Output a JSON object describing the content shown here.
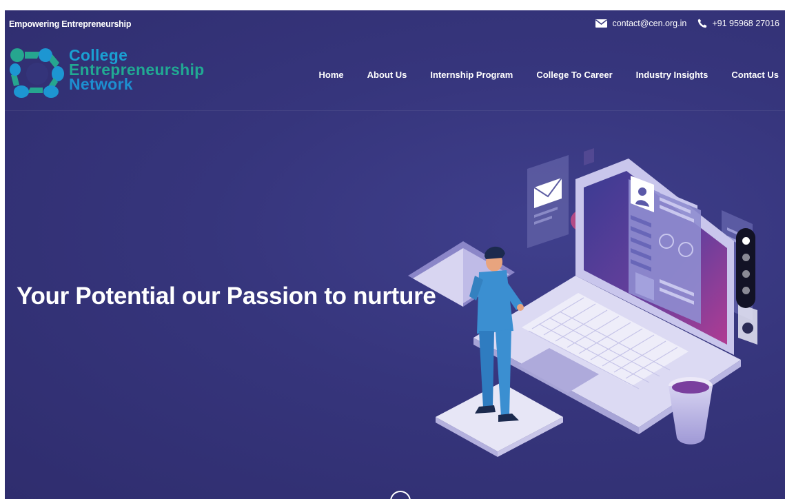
{
  "topbar": {
    "tagline": "Empowering Entrepreneurship",
    "email": "contact@cen.org.in",
    "phone": "+91 95968 27016",
    "email_icon": "envelope-icon",
    "phone_icon": "phone-icon"
  },
  "logo": {
    "line1": "College",
    "line2": "Entrepreneurship",
    "line3": "Network",
    "mark_icon": "network-circle-logo"
  },
  "nav": {
    "items": [
      "Home",
      "About Us",
      "Internship Program",
      "College To Career",
      "Industry Insights",
      "Contact Us"
    ]
  },
  "hero": {
    "title": "Your Potential our Passion to nurture",
    "slides_total": 4,
    "slide_active": 1
  },
  "colors": {
    "background": "#36357c",
    "logo_blue": "#1aa0d3",
    "logo_teal": "#21a993",
    "text": "#ffffff"
  }
}
